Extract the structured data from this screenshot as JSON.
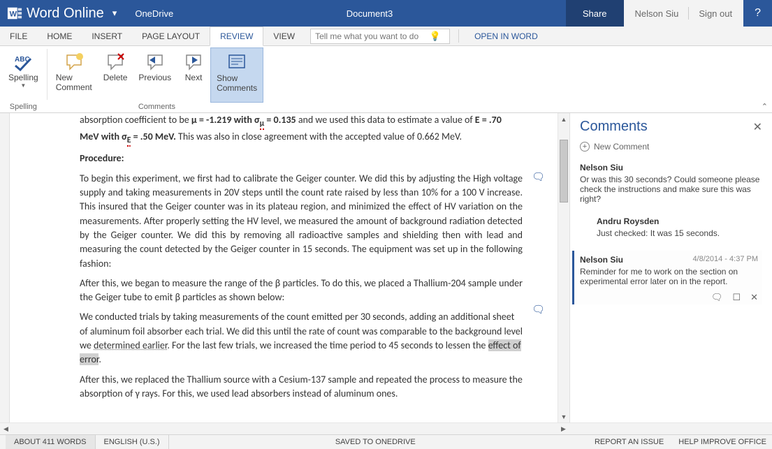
{
  "header": {
    "app_name": "Word Online",
    "location": "OneDrive",
    "doc_title": "Document3",
    "share": "Share",
    "user": "Nelson Siu",
    "signout": "Sign out"
  },
  "tabs": {
    "file": "FILE",
    "home": "HOME",
    "insert": "INSERT",
    "page_layout": "PAGE LAYOUT",
    "review": "REVIEW",
    "view": "VIEW",
    "search_placeholder": "Tell me what you want to do",
    "open_in_word": "OPEN IN WORD"
  },
  "ribbon": {
    "spelling": "Spelling",
    "spelling_group": "Spelling",
    "new_comment": "New Comment",
    "delete": "Delete",
    "previous": "Previous",
    "next": "Next",
    "show_comments": "Show Comments",
    "comments_group": "Comments"
  },
  "doc": {
    "intro1": "absorption coefficient to be ",
    "intro2": "μ = -1.219 with σ",
    "intro2sub": "μ",
    "intro3": " = 0.135",
    "intro4": " and we used this data to estimate a value of ",
    "intro5": "E = .70 MeV with σ",
    "intro5sub": "E",
    "intro6": " = .50 MeV.",
    "intro7": " This was also in close agreement with the accepted value of 0.662 MeV.",
    "procedure": "Procedure:",
    "p1": "To begin this experiment, we first had to calibrate the Geiger counter. We did this by adjusting the High voltage supply and taking measurements in 20V steps until the count rate raised by less than 10% for a 100 V increase. This insured that the Geiger counter was in its plateau region, and minimized the effect of HV variation on the measurements. After properly setting the HV level, we measured the amount of background radiation detected by the Geiger counter. We did this by removing all radioactive samples and shielding then with lead and measuring the count detected by the Geiger counter in 15 seconds. The equipment was set up in the following fashion:",
    "p2": "After this, we began to measure the range of the β particles. To do this, we placed a Thallium-204 sample under the Geiger tube to emit β particles as shown below:",
    "p3a": "We conducted trials by taking measurements of the count emitted per 30 seconds, adding an additional sheet of aluminum foil absorber each trial. We did this until the rate of count was comparable to the background level we ",
    "p3u": "determined earlier",
    "p3b": ". For the last few trials, we increased the time period to 45 seconds to lessen the ",
    "p3hl": "effect of error",
    "p3c": ".",
    "p4": "After this, we replaced the Thallium source with a Cesium-137 sample and repeated the process to measure the absorption of γ rays. For this, we used lead absorbers instead of aluminum ones."
  },
  "comments": {
    "title": "Comments",
    "new": "New Comment",
    "c1": {
      "author": "Nelson Siu",
      "text": "Or was this 30 seconds?  Could someone please check the instructions and make sure this was right?"
    },
    "c2": {
      "author": "Andru Roysden",
      "text": "Just checked: It was 15 seconds."
    },
    "c3": {
      "author": "Nelson Siu",
      "time": "4/8/2014 - 4:37 PM",
      "text": "Reminder for me to work on the section on experimental error later on in the report."
    }
  },
  "status": {
    "words": "ABOUT 411 WORDS",
    "lang": "ENGLISH (U.S.)",
    "saved": "SAVED TO ONEDRIVE",
    "issue": "REPORT AN ISSUE",
    "help": "HELP IMPROVE OFFICE"
  }
}
